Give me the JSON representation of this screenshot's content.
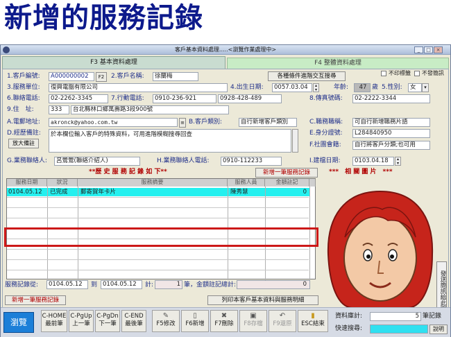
{
  "banner": "新增的服務記錄",
  "window": {
    "title": "客戶基本資料處理.....<瀏覽作業處理中>"
  },
  "tabs": [
    "F3 基本資料處理",
    "F4 整體資料處理"
  ],
  "form": {
    "l_customer_no": "1.客戶編號:",
    "customer_no": "A000000002",
    "f2_btn": "F2",
    "l_customer_name": "2.客戶名稱:",
    "customer_name": "徐蘭梅",
    "cond_search_btn": "各種條件進階交互搜尋",
    "chk_no_label": "不印標籤",
    "chk_no_letter": "不發簡訊",
    "l_unit": "3.服務單位:",
    "unit": "復興電腦有限公司",
    "l_birth": "4.出生日期:",
    "birth": "0057.03.04",
    "l_age": "年齡:",
    "age": "47",
    "age_unit": "歲",
    "l_gender": "5.性別:",
    "gender": "女",
    "l_phone": "6.聯絡電話:",
    "phone": "02-2262-3345",
    "l_mobile": "7.行動電話:",
    "mobile": "0910-236-921",
    "mobile2": "0928-428-489",
    "l_fax": "8.傳真號碼:",
    "fax": "02-2222-3344",
    "l_addr": "9.住　址:",
    "zip": "333",
    "addr": "台北縣林口鄉萬壽路3段900號",
    "l_email": "A.電郵地址:",
    "email": "akronck@yahoo.com.tw",
    "l_category": "B.客戶類別:",
    "category": "自行新增客戶類別",
    "l_job": "C.職務職稱:",
    "job": "可自行新增職務片語",
    "l_notes": "D.經歷備註:",
    "notes": "於本欄位輸入客戶的特殊資料，可用進階模糊搜尋回查",
    "enlarge_btn": "放大備註",
    "l_id": "E.身分證號:",
    "id": "L284840950",
    "l_social": "F.社團會籍:",
    "social": "自行將客戶分類;也可用",
    "l_contact": "G.業務聯絡人:",
    "contact": "呂鶯鶯(聯絡介紹人)",
    "l_contact_phone": "H.業務聯絡人電話:",
    "contact_phone": "0910-112233",
    "l_created": "I.建檔日期:",
    "created": "0103.04.18"
  },
  "history": {
    "heading": "**歷 史 服 務 記 錄 如 下**",
    "add_btn": "新增一筆服務記錄",
    "columns": [
      "服務日期",
      "狀況",
      "服務摘要",
      "服務人員",
      "金額註記"
    ],
    "rows": [
      {
        "date": "0104.05.12",
        "status": "已完成",
        "summary": "郵寄賀年卡片",
        "staff": "陳秀慧",
        "amount": "0"
      }
    ],
    "l_range": "服務記錄從:",
    "from": "0104.05.12",
    "l_to": "到",
    "to": "0104.05.12",
    "l_count": "計:",
    "count": "1",
    "l_sum": "筆，金額註記總計:",
    "sum": "0",
    "add_btn2": "新增一筆服務記錄",
    "print_btn": "列印本客戶基本資料與服務明細"
  },
  "photo": {
    "heading": "***　相 關 圖 片　***",
    "sms_btn": "發送簡訊給此客戶"
  },
  "toolbar": {
    "browse": "瀏覽",
    "buttons": [
      {
        "key": "C-HOME",
        "label": "最前筆"
      },
      {
        "key": "C-PgUp",
        "label": "上一筆"
      },
      {
        "key": "C-PgDn",
        "label": "下一筆"
      },
      {
        "key": "C-END",
        "label": "最後筆"
      }
    ],
    "func": [
      "F5修改",
      "F6新增",
      "F7刪除",
      "F8存檔",
      "F9還原",
      "ESC結束"
    ],
    "l_total": "資料庫計:",
    "total": "5",
    "total_unit": "筆記錄",
    "l_quick": "快速搜尋:",
    "help_btn": "說明"
  }
}
